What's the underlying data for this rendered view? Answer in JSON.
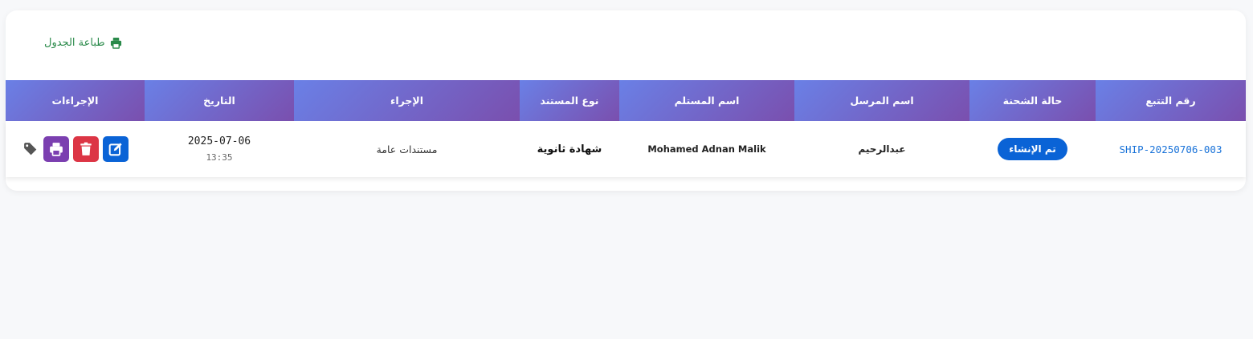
{
  "toolbar": {
    "print_table_label": "طباعة الجدول",
    "accent_color": "#2a8a4a"
  },
  "table": {
    "headers": {
      "tracking": "رقم التتبع",
      "status": "حالة الشحنة",
      "sender": "اسم المرسل",
      "receiver": "اسم المستلم",
      "doc_type": "نوع المستند",
      "procedure": "الإجراء",
      "date": "التاريخ",
      "actions": "الإجراءات"
    },
    "rows": [
      {
        "tracking": "SHIP-20250706-003",
        "status": "تم الإنشاء",
        "sender": "عبدالرحيم",
        "receiver": "Mohamed Adnan Malik",
        "doc_type": "شهادة ثانوية",
        "procedure": "مستندات عامة",
        "date": "2025-07-06",
        "time": "13:35"
      }
    ]
  },
  "icons": {
    "print_link": "printer-icon",
    "edit": "edit-icon",
    "delete": "trash-icon",
    "print_row": "printer-icon",
    "tag": "tag-icon"
  },
  "colors": {
    "header_gradient_start": "#6a80e6",
    "header_gradient_end": "#7a4fae",
    "status_badge": "#0a63d6",
    "edit_button": "#0a63d6",
    "delete_button": "#dc3545",
    "print_button": "#7b3fb0",
    "tracking_link": "#1a73d9"
  }
}
